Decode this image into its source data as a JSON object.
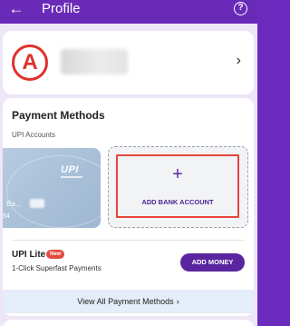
{
  "header": {
    "title": "Profile",
    "back_icon": "arrow-left-icon",
    "help_icon": "question-circle-icon"
  },
  "profile": {
    "avatar_letter": "A",
    "avatar_color": "#e0312b"
  },
  "payment_methods": {
    "title": "Payment Methods",
    "upi_accounts_label": "UPI Accounts",
    "bank_card": {
      "brand": "UPI",
      "name_prefix": "Ba...",
      "number_suffix": "54"
    },
    "add_bank_label": "ADD BANK ACCOUNT",
    "add_bank_plus": "+",
    "upi_lite": {
      "title": "UPI Lite",
      "badge": "New",
      "subtitle": "1-Click Superfast Payments",
      "button": "ADD MONEY"
    },
    "view_all": "View All Payment Methods",
    "view_all_chevron": "›"
  },
  "colors": {
    "brand_purple": "#6a2ab8",
    "accent_red": "#e8453c"
  }
}
